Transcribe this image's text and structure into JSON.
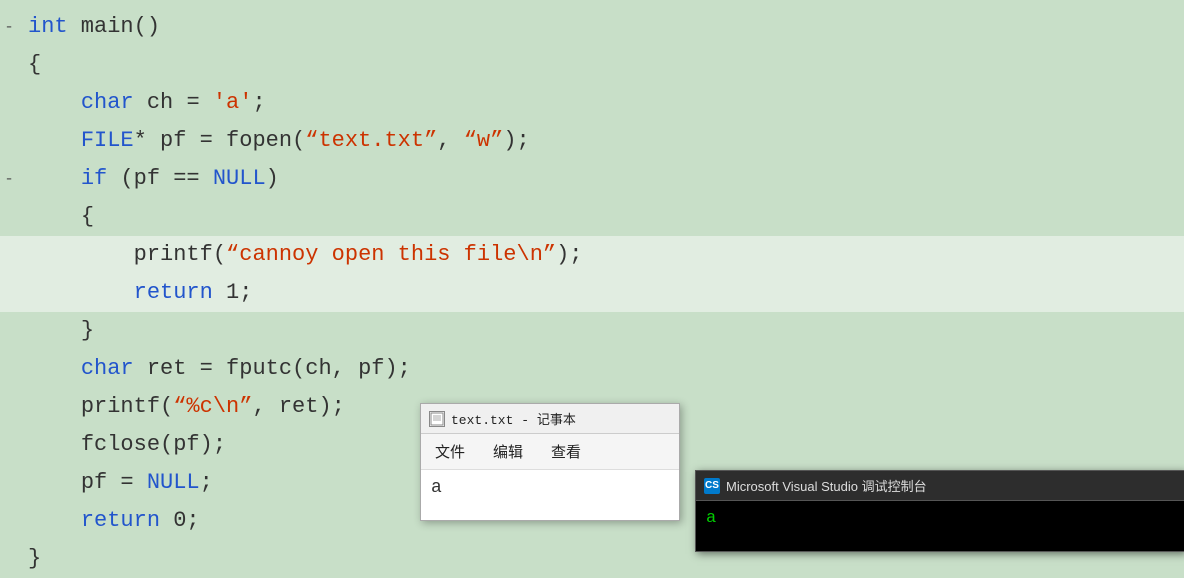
{
  "code": {
    "lines": [
      {
        "id": 1,
        "indent": 0,
        "indicator": "-",
        "tokens": [
          {
            "type": "kw",
            "text": "int"
          },
          {
            "type": "plain",
            "text": " main"
          },
          {
            "type": "plain",
            "text": "()"
          }
        ]
      },
      {
        "id": 2,
        "indent": 0,
        "indicator": "",
        "tokens": [
          {
            "type": "plain",
            "text": "{"
          }
        ]
      },
      {
        "id": 3,
        "indent": 1,
        "indicator": "",
        "tokens": [
          {
            "type": "kw",
            "text": "char"
          },
          {
            "type": "plain",
            "text": " ch "
          },
          {
            "type": "op",
            "text": "="
          },
          {
            "type": "plain",
            "text": " "
          },
          {
            "type": "ch",
            "text": "'a'"
          },
          {
            "type": "plain",
            "text": ";"
          }
        ]
      },
      {
        "id": 4,
        "indent": 1,
        "indicator": "",
        "tokens": [
          {
            "type": "macro",
            "text": "FILE"
          },
          {
            "type": "plain",
            "text": "* pf "
          },
          {
            "type": "op",
            "text": "="
          },
          {
            "type": "plain",
            "text": " fopen("
          },
          {
            "type": "str",
            "text": "“text.txt”"
          },
          {
            "type": "plain",
            "text": ", "
          },
          {
            "type": "str",
            "text": "“w”"
          },
          {
            "type": "plain",
            "text": ");"
          }
        ]
      },
      {
        "id": 5,
        "indent": 1,
        "indicator": "-",
        "tokens": [
          {
            "type": "kw",
            "text": "if"
          },
          {
            "type": "plain",
            "text": " (pf "
          },
          {
            "type": "op",
            "text": "=="
          },
          {
            "type": "plain",
            "text": " "
          },
          {
            "type": "macro",
            "text": "NULL"
          },
          {
            "type": "plain",
            "text": ")"
          }
        ]
      },
      {
        "id": 6,
        "indent": 1,
        "indicator": "",
        "tokens": [
          {
            "type": "plain",
            "text": "{"
          }
        ]
      },
      {
        "id": 7,
        "indent": 2,
        "indicator": "",
        "tokens": [
          {
            "type": "plain",
            "text": "printf("
          },
          {
            "type": "str",
            "text": "“cannoy open this file\\n”"
          },
          {
            "type": "plain",
            "text": ");"
          }
        ],
        "highlighted": true
      },
      {
        "id": 8,
        "indent": 2,
        "indicator": "",
        "tokens": [
          {
            "type": "kw",
            "text": "return"
          },
          {
            "type": "plain",
            "text": " 1;"
          }
        ],
        "highlighted": true
      },
      {
        "id": 9,
        "indent": 1,
        "indicator": "",
        "tokens": [
          {
            "type": "plain",
            "text": "}"
          }
        ]
      },
      {
        "id": 10,
        "indent": 1,
        "indicator": "",
        "tokens": [
          {
            "type": "kw",
            "text": "char"
          },
          {
            "type": "plain",
            "text": " ret "
          },
          {
            "type": "op",
            "text": "="
          },
          {
            "type": "plain",
            "text": " fputc(ch, pf);"
          }
        ]
      },
      {
        "id": 11,
        "indent": 1,
        "indicator": "",
        "tokens": [
          {
            "type": "plain",
            "text": "printf("
          },
          {
            "type": "str",
            "text": "“%c\\n”"
          },
          {
            "type": "plain",
            "text": ", ret);"
          }
        ]
      },
      {
        "id": 12,
        "indent": 1,
        "indicator": "",
        "tokens": [
          {
            "type": "plain",
            "text": "fclose(pf);"
          }
        ]
      },
      {
        "id": 13,
        "indent": 1,
        "indicator": "",
        "tokens": [
          {
            "type": "plain",
            "text": "pf "
          },
          {
            "type": "op",
            "text": "="
          },
          {
            "type": "plain",
            "text": " "
          },
          {
            "type": "macro",
            "text": "NULL"
          },
          {
            "type": "plain",
            "text": ";"
          }
        ]
      },
      {
        "id": 14,
        "indent": 1,
        "indicator": "",
        "tokens": [
          {
            "type": "kw",
            "text": "return"
          },
          {
            "type": "plain",
            "text": " 0;"
          }
        ]
      },
      {
        "id": 15,
        "indent": 0,
        "indicator": "",
        "tokens": [
          {
            "type": "plain",
            "text": "}"
          }
        ]
      }
    ]
  },
  "notepad": {
    "title": "text.txt - 记事本",
    "icon": "notepad-icon",
    "menu": [
      "文件",
      "编辑",
      "查看"
    ],
    "content": "a"
  },
  "vs_console": {
    "title": "Microsoft Visual Studio 调试控制台",
    "icon": "vs-icon",
    "icon_label": "CS",
    "content": "a"
  }
}
